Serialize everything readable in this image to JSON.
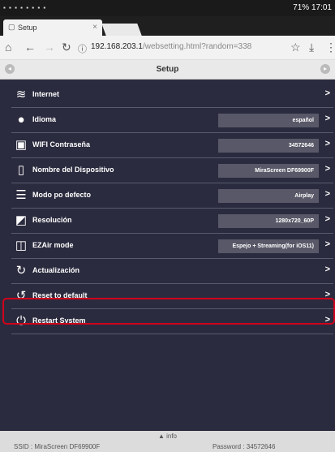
{
  "status_bar": {
    "left_icons": "▪ ▪ ▪ ▪ ▪ ▪ ▪ ▪",
    "right": "71% 17:01"
  },
  "browser": {
    "tab_title": "Setup",
    "tab_close": "×",
    "url": "192.168.203.1",
    "url_path": "/websetting.html?random=338"
  },
  "page": {
    "title": "Setup"
  },
  "menu": {
    "items": [
      {
        "label": "Internet",
        "value": "",
        "icon": "wifi-icon"
      },
      {
        "label": "Idioma",
        "value": "español",
        "icon": "globe-icon"
      },
      {
        "label": "WIFI Contraseña",
        "value": "34572646",
        "icon": "lock-icon"
      },
      {
        "label": "Nombre del Dispositivo",
        "value": "MiraScreen DF69900F",
        "icon": "device-edit-icon"
      },
      {
        "label": "Modo po defecto",
        "value": "Airplay",
        "icon": "list-icon"
      },
      {
        "label": "Resolución",
        "value": "1280x720_60P",
        "icon": "resolution-icon"
      },
      {
        "label": "EZAir mode",
        "value": "Espejo + Streaming(for iOS11)",
        "icon": "mirror-icon"
      },
      {
        "label": "Actualización",
        "value": "",
        "icon": "update-icon"
      },
      {
        "label": "Reset to default",
        "value": "",
        "icon": "reset-icon"
      },
      {
        "label": "Restart System",
        "value": "",
        "icon": "power-icon"
      }
    ]
  },
  "footer": {
    "info": "info",
    "ssid": "SSID : MiraScreen DF69900F",
    "password": "Password : 34572646"
  }
}
